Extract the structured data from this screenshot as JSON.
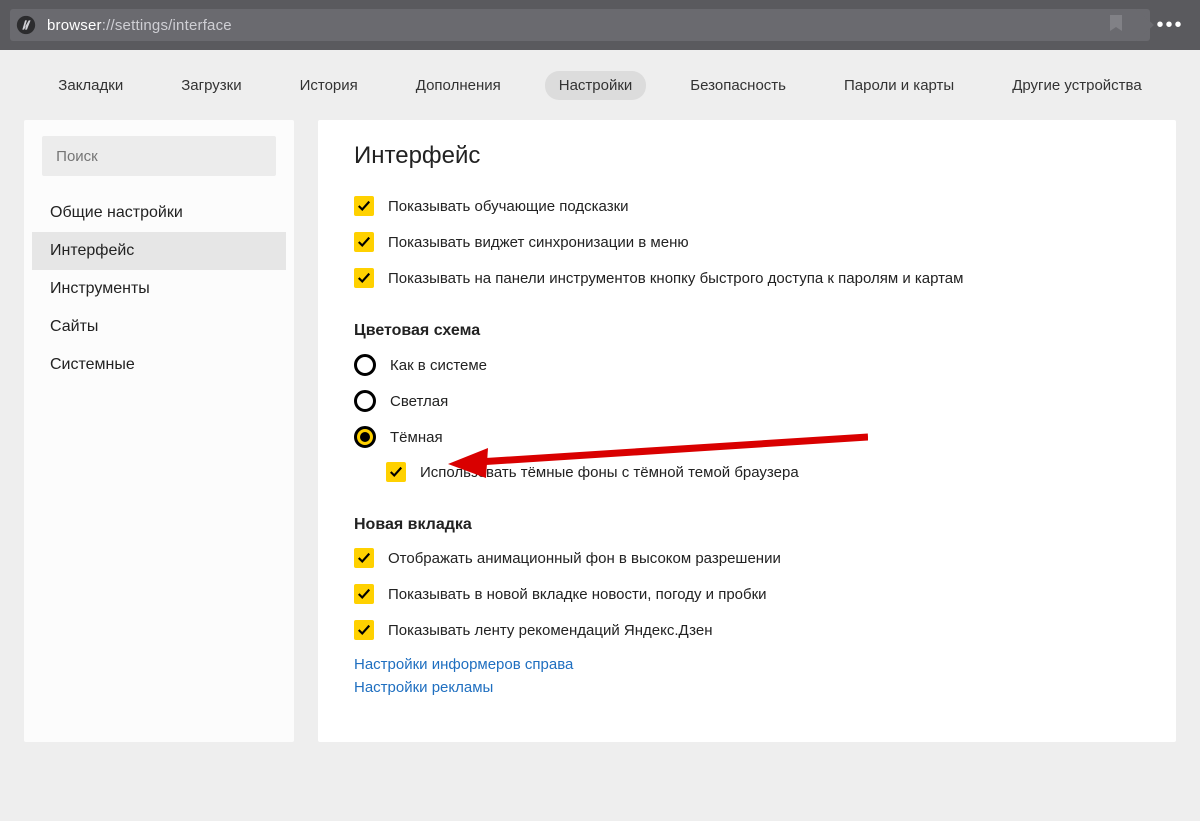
{
  "address_bar": {
    "url_proto": "browser",
    "url_rest": "://settings/interface"
  },
  "topnav": {
    "items": [
      "Закладки",
      "Загрузки",
      "История",
      "Дополнения",
      "Настройки",
      "Безопасность",
      "Пароли и карты",
      "Другие устройства"
    ],
    "active_index": 4
  },
  "sidebar": {
    "search_placeholder": "Поиск",
    "items": [
      "Общие настройки",
      "Интерфейс",
      "Инструменты",
      "Сайты",
      "Системные"
    ],
    "active_index": 1
  },
  "content": {
    "title": "Интерфейс",
    "top_checks": [
      "Показывать обучающие подсказки",
      "Показывать виджет синхронизации в меню",
      "Показывать на панели инструментов кнопку быстрого доступа к паролям и картам"
    ],
    "color_scheme": {
      "heading": "Цветовая схема",
      "options": [
        "Как в системе",
        "Светлая",
        "Тёмная"
      ],
      "selected_index": 2,
      "sub_check": "Использовать тёмные фоны с тёмной темой браузера"
    },
    "new_tab": {
      "heading": "Новая вкладка",
      "checks": [
        "Отображать анимационный фон в высоком разрешении",
        "Показывать в новой вкладке новости, погоду и пробки",
        "Показывать ленту рекомендаций Яндекс.Дзен"
      ],
      "links": [
        "Настройки информеров справа",
        "Настройки рекламы"
      ]
    }
  }
}
